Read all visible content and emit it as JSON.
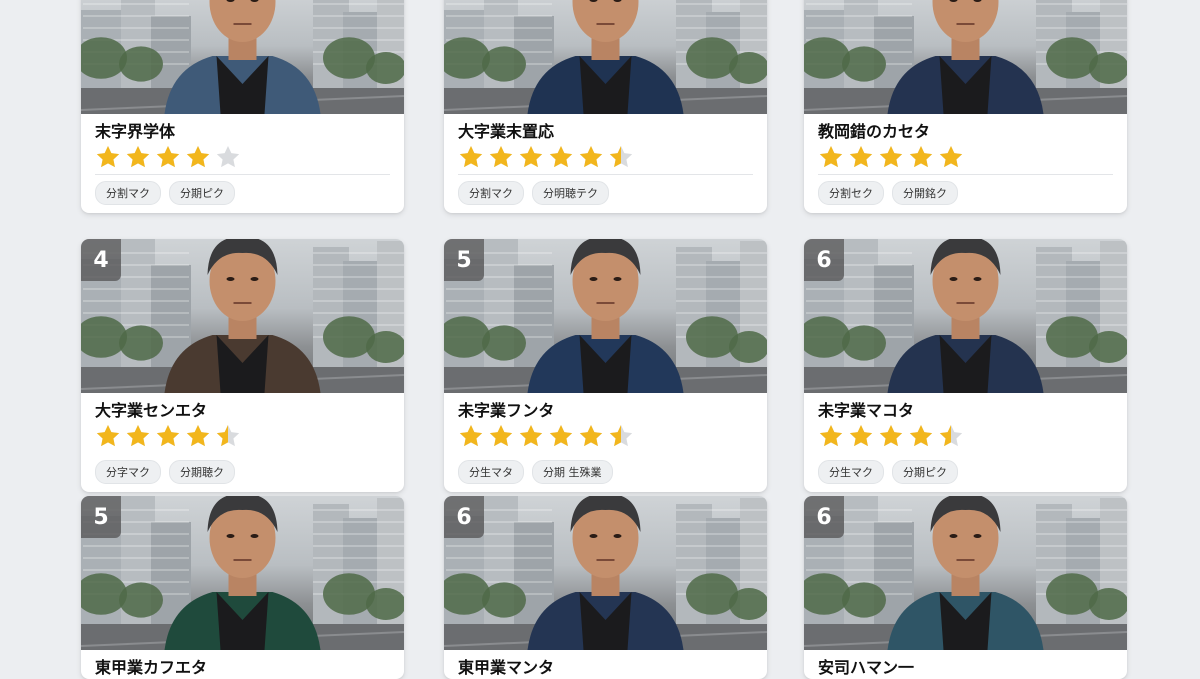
{
  "cards": [
    {
      "name": "末字界学体",
      "rating": 4,
      "tags": [
        "分割マク",
        "分期ピク"
      ],
      "jacket": "#3f5a78",
      "rank": ""
    },
    {
      "name": "大字業末置応",
      "rating": 5.5,
      "tags": [
        "分割マク",
        "分明聴テク"
      ],
      "jacket": "#1f3352",
      "rank": ""
    },
    {
      "name": "教岡錯のカセタ",
      "rating": 5,
      "tags": [
        "分割セク",
        "分開銘ク"
      ],
      "jacket": "#243350",
      "rank": ""
    },
    {
      "name": "大字業センエタ",
      "rating": 4.5,
      "tags": [
        "分字マク",
        "分期聴ク"
      ],
      "jacket": "#4a3a30",
      "rank": "4"
    },
    {
      "name": "未字業フンタ",
      "rating": 5.5,
      "tags": [
        "分生マタ",
        "分期 生殊業"
      ],
      "jacket": "#22385a",
      "rank": "5"
    },
    {
      "name": "未字業マコタ",
      "rating": 4.5,
      "tags": [
        "分生マク",
        "分期ピク"
      ],
      "jacket": "#24334f",
      "rank": "6"
    },
    {
      "name": "東甲業カフエタ",
      "rating": 0,
      "tags": [],
      "jacket": "#1f4a3c",
      "rank": "5"
    },
    {
      "name": "東甲業マンタ",
      "rating": 0,
      "tags": [],
      "jacket": "#243553",
      "rank": "6"
    },
    {
      "name": "安司ハマン一",
      "rating": 0,
      "tags": [],
      "jacket": "#2f5566",
      "rank": "6"
    }
  ]
}
